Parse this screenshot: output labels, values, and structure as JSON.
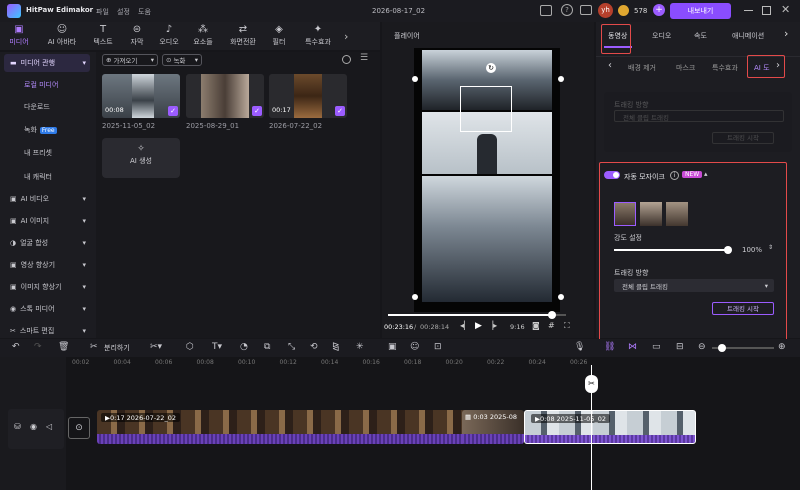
{
  "app": {
    "name": "HitPaw Edimakor",
    "menus": [
      "파일",
      "설정",
      "도움"
    ],
    "project_title": "2026-08-17_02",
    "credits": "578",
    "avatar": "yh",
    "export_label": "내보내기"
  },
  "toolbar": {
    "tabs": [
      "미디어",
      "AI 아바타",
      "텍스트",
      "자막",
      "오디오",
      "요소들",
      "화면전환",
      "필터",
      "특수효과"
    ]
  },
  "sidebar": {
    "items": [
      {
        "label": "미디어 관행",
        "kind": "header"
      },
      {
        "label": "로컬 미디어",
        "kind": "sub-active"
      },
      {
        "label": "다운로드",
        "kind": "sub"
      },
      {
        "label": "녹화",
        "kind": "sub",
        "badge": "Free"
      },
      {
        "label": "내 프리셋",
        "kind": "sub"
      },
      {
        "label": "내 캐릭터",
        "kind": "sub"
      },
      {
        "label": "AI 비디오",
        "kind": "group"
      },
      {
        "label": "AI 이미지",
        "kind": "group"
      },
      {
        "label": "얼굴 합성",
        "kind": "group"
      },
      {
        "label": "영상 향상기",
        "kind": "group"
      },
      {
        "label": "이미지 향상기",
        "kind": "group"
      },
      {
        "label": "스톡 미디어",
        "kind": "group"
      },
      {
        "label": "스마트 편집",
        "kind": "group"
      }
    ]
  },
  "media": {
    "import_label": "가져오기",
    "record_label": "녹화",
    "ai_generate_label": "AI 생성",
    "items": [
      {
        "duration": "00:08",
        "name": "2025-11-05_02"
      },
      {
        "duration": "",
        "name": "2025-08-29_01"
      },
      {
        "duration": "00:17",
        "name": "2026-07-22_02"
      }
    ]
  },
  "player": {
    "title": "플레이어",
    "current_time": "00:23:16",
    "total_time": "00:28:14",
    "ratio": "9:16"
  },
  "right_panel": {
    "tabs": [
      "동영상",
      "오디오",
      "속도",
      "애니메이션"
    ],
    "subtabs": [
      "배경 제거",
      "마스크",
      "특수효과",
      "AI 도"
    ],
    "tracking_dir_label": "트래킹 방향",
    "tracking_dir_value": "전체 클립 트래킹",
    "tracking_start_disabled": "트래킹 시작",
    "auto_mosaic_label": "자동 모자이크",
    "new_badge": "NEW",
    "strength_label": "강도 설정",
    "strength_value": "100%",
    "strength_fraction": 1.0,
    "tracking_dir_label2": "트래킹 방향",
    "tracking_dir_value2": "전체 클립 트래킹",
    "tracking_start": "트래킹 시작"
  },
  "timeline_tools": {
    "split_label": "분리하기"
  },
  "timeline": {
    "ruler": [
      "00:02",
      "00:04",
      "00:06",
      "00:08",
      "00:10",
      "00:12",
      "00:14",
      "00:16",
      "00:18",
      "00:20",
      "00:22",
      "00:24",
      "00:26"
    ],
    "clips": [
      {
        "label": "0:17  2026-07-22_02"
      },
      {
        "label": "0:03  2025-08"
      },
      {
        "label": "0:08  2025-11-05_02"
      }
    ]
  }
}
